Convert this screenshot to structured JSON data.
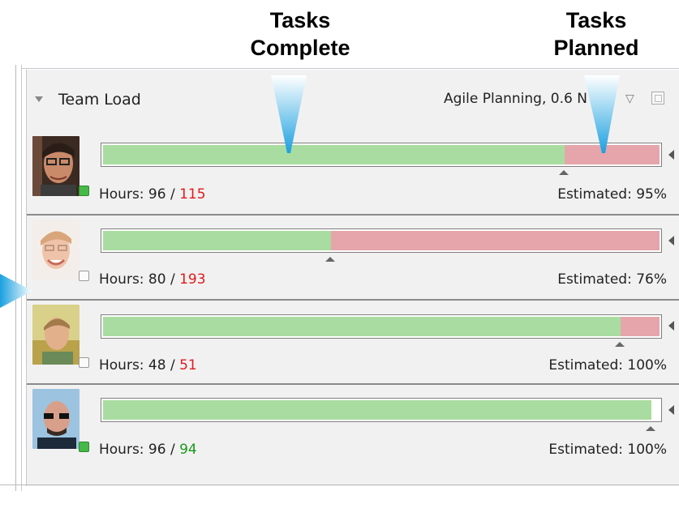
{
  "callouts": {
    "complete": [
      "Tasks",
      "Complete"
    ],
    "planned": [
      "Tasks",
      "Planned"
    ]
  },
  "panel": {
    "title": "Team Load",
    "context": "Agile Planning, 0.6 N",
    "icons": [
      "triangle-down-icon",
      "filter-icon",
      "expand-icon"
    ]
  },
  "colors": {
    "complete": "#a9dca0",
    "planned": "#e6a5aa",
    "over": "#e11a1a",
    "under": "#1a9a1a",
    "online": "#46b848",
    "callout_wedge": "#1ba0e0"
  },
  "members": [
    {
      "hours_label": "Hours: 96 / ",
      "hours_done": 96,
      "hours_planned": "115",
      "planned_state": "over",
      "estimated": "Estimated: 95%",
      "status": "online",
      "complete_fraction": 0.83,
      "planned_fraction": 1.0,
      "estimate_fraction": 0.83
    },
    {
      "hours_label": "Hours: 80 / ",
      "hours_done": 80,
      "hours_planned": "193",
      "planned_state": "over",
      "estimated": "Estimated: 76%",
      "status": "offline",
      "complete_fraction": 0.41,
      "planned_fraction": 1.0,
      "estimate_fraction": 0.41
    },
    {
      "hours_label": "Hours: 48 / ",
      "hours_done": 48,
      "hours_planned": "51",
      "planned_state": "over",
      "estimated": "Estimated: 100%",
      "status": "offline",
      "complete_fraction": 0.93,
      "planned_fraction": 1.0,
      "estimate_fraction": 0.93
    },
    {
      "hours_label": "Hours: 96 / ",
      "hours_done": 96,
      "hours_planned": "94",
      "planned_state": "under",
      "estimated": "Estimated: 100%",
      "status": "online",
      "complete_fraction": 0.985,
      "planned_fraction": 0.0,
      "estimate_fraction": 0.985
    }
  ]
}
